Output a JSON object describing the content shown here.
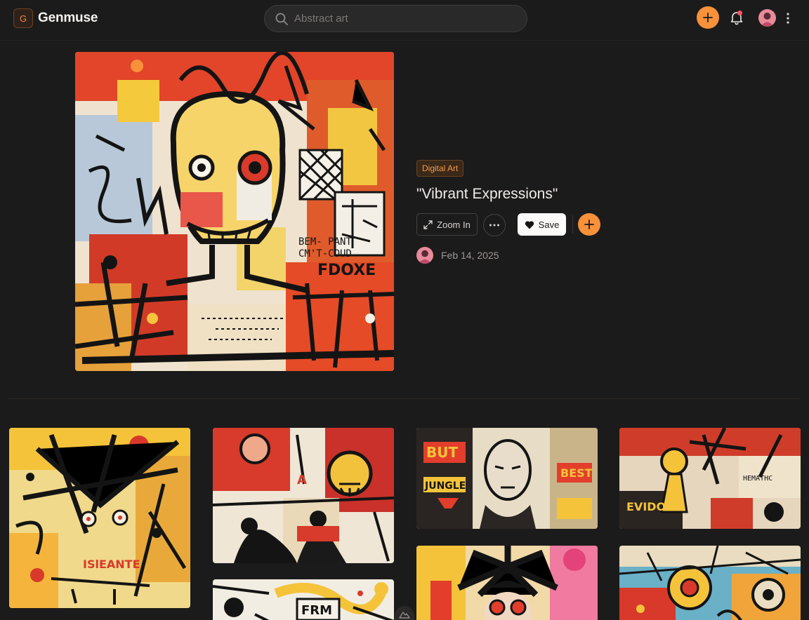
{
  "app": {
    "logo_letter": "G",
    "name": "Genmuse"
  },
  "search": {
    "placeholder": "Abstract art"
  },
  "colors": {
    "accent": "#f7913a",
    "background": "#1c1b1b",
    "notification_dot": "#ff5263"
  },
  "header_icons": [
    "search-icon",
    "plus-icon",
    "bell-icon",
    "avatar",
    "more-vertical-icon"
  ],
  "artwork": {
    "category": "Digital Art",
    "title": "\"Vibrant Expressions\"",
    "date": "Feb 14, 2025"
  },
  "actions": {
    "zoom_label": "Zoom In",
    "save_label": "Save"
  },
  "gallery": {
    "columns": 4,
    "tile_count": 9
  }
}
